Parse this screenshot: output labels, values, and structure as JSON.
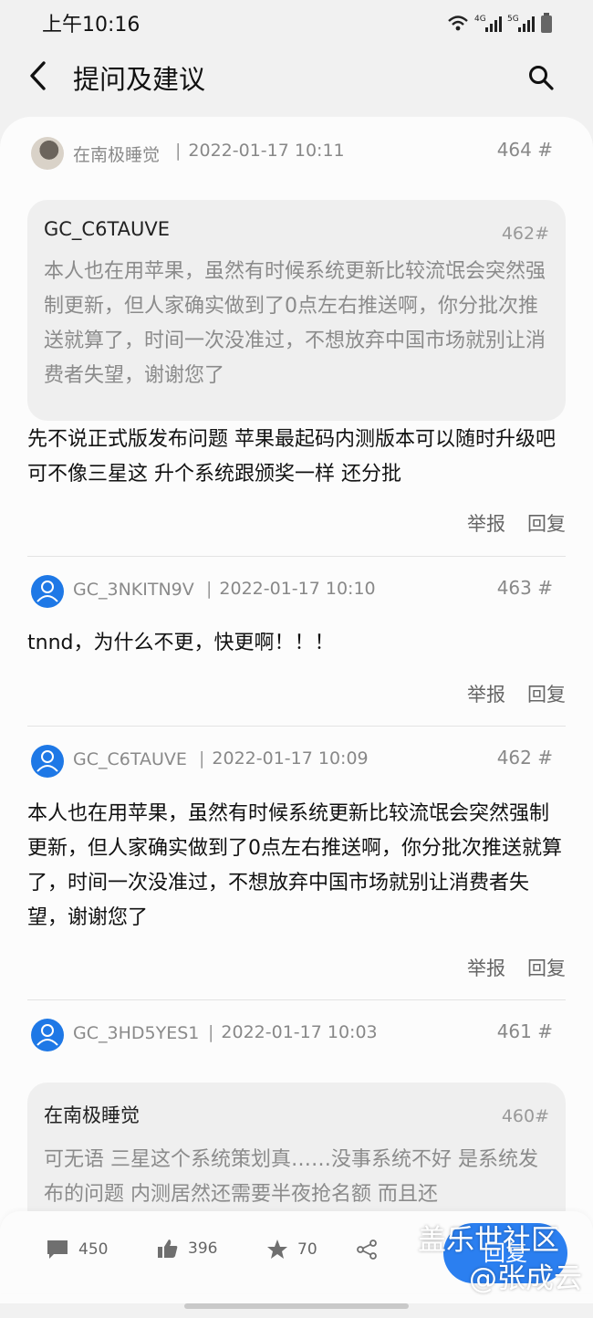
{
  "status_bar": {
    "time": "上午10:16",
    "network_labels": [
      "4G",
      "5G"
    ]
  },
  "header": {
    "title": "提问及建议"
  },
  "posts": [
    {
      "username": "在南极睡觉",
      "time": "2022-01-17 10:11",
      "floor": "464 #",
      "avatar": "photo",
      "quote": {
        "username": "GC_C6TAUVE",
        "floor": "462#",
        "text": "本人也在用苹果，虽然有时候系统更新比较流氓会突然强制更新，但人家确实做到了0点左右推送啊，你分批次推送就算了，时间一次没准过，不想放弃中国市场就别让消费者失望，谢谢您了"
      },
      "text": "先不说正式版发布问题 苹果最起码内测版本可以随时升级吧 可不像三星这 升个系统跟颁奖一样 还分批"
    },
    {
      "username": "GC_3NKITN9V",
      "time": "2022-01-17 10:10",
      "floor": "463 #",
      "avatar": "blue",
      "text": "tnnd，为什么不更，快更啊！！！"
    },
    {
      "username": "GC_C6TAUVE",
      "time": "2022-01-17 10:09",
      "floor": "462 #",
      "avatar": "blue",
      "text": "本人也在用苹果，虽然有时候系统更新比较流氓会突然强制更新，但人家确实做到了0点左右推送啊，你分批次推送就算了，时间一次没准过，不想放弃中国市场就别让消费者失望，谢谢您了"
    },
    {
      "username": "GC_3HD5YES1",
      "time": "2022-01-17 10:03",
      "floor": "461 #",
      "avatar": "blue",
      "quote": {
        "username": "在南极睡觉",
        "floor": "460#",
        "text": "可无语 三星这个系统策划真……没事系统不好 是系统发布的问题 内测居然还需要半夜抢名额 而且还"
      }
    }
  ],
  "actions": {
    "report": "举报",
    "reply": "回复"
  },
  "toolbar": {
    "comments": "450",
    "likes": "396",
    "favorites": "70",
    "reply_button": "回复"
  },
  "watermark": {
    "line1": "盖乐世社区",
    "line2": "@张成云"
  },
  "colors": {
    "accent": "#2b7ff0",
    "avatar_blue": "#1e78e6",
    "quote_bg": "#efefef"
  }
}
